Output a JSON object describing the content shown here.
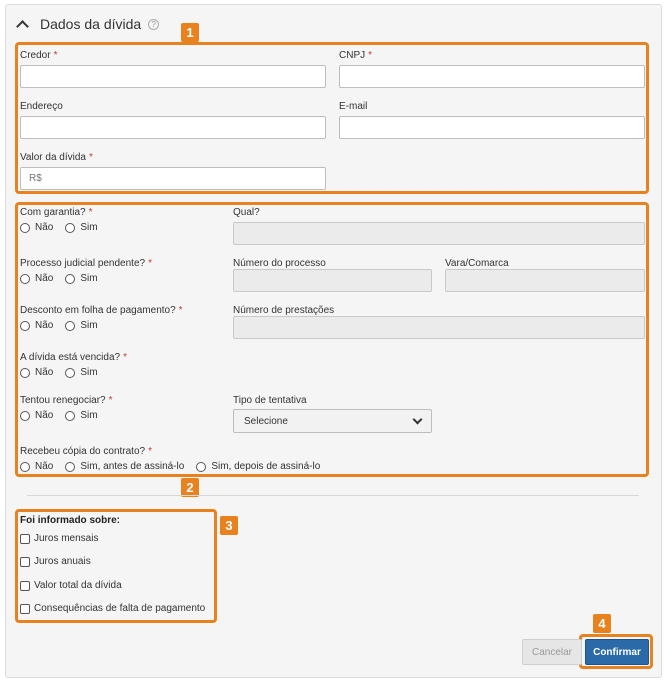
{
  "panel": {
    "title": "Dados da dívida",
    "help_icon": "question-circle-icon"
  },
  "badges": [
    "1",
    "2",
    "3",
    "4"
  ],
  "section1": {
    "credor_label": "Credor",
    "cnpj_label": "CNPJ",
    "endereco_label": "Endereço",
    "email_label": "E-mail",
    "valor_label": "Valor da dívida",
    "valor_placeholder": "R$"
  },
  "required_mark": "*",
  "section2": {
    "garantia_label": "Com garantia?",
    "qual_label": "Qual?",
    "processo_label": "Processo judicial pendente?",
    "numero_processo_label": "Número do processo",
    "vara_label": "Vara/Comarca",
    "desconto_label": "Desconto em folha de pagamento?",
    "prestacoes_label": "Número de prestações",
    "vencida_label": "A dívida está vencida?",
    "renegociar_label": "Tentou renegociar?",
    "tipo_tentativa_label": "Tipo de tentativa",
    "tipo_tentativa_value": "Selecione",
    "copia_label": "Recebeu cópia do contrato?",
    "opt_nao": "Não",
    "opt_sim": "Sim",
    "opt_sim_antes": "Sim, antes de assiná-lo",
    "opt_sim_depois": "Sim, depois de assiná-lo"
  },
  "section3": {
    "title": "Foi informado sobre:",
    "items": [
      "Juros mensais",
      "Juros anuais",
      "Valor total da dívida",
      "Consequências de falta de pagamento"
    ]
  },
  "actions": {
    "cancel": "Cancelar",
    "confirm": "Confirmar"
  },
  "colors": {
    "highlight": "#e8821e",
    "primary": "#2b6aa8"
  }
}
